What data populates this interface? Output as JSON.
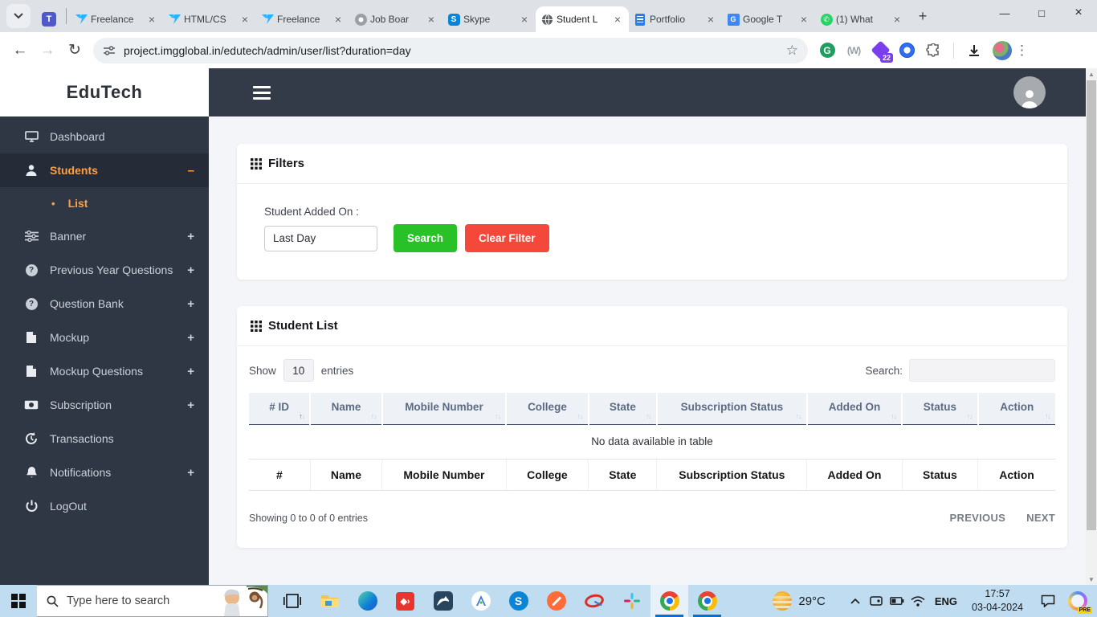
{
  "glyphs": {
    "plus": "+",
    "minus": "–",
    "bullet": "•",
    "question": "?",
    "close": "×",
    "new_tab": "+",
    "minimize": "—",
    "maximize": "□",
    "back": "←",
    "forward": "→",
    "reload": "↻",
    "star": "☆",
    "kebab": "⋮",
    "sort_up": "↑",
    "sort_down": "↓",
    "scroll_up": "▲",
    "scroll_down": "▼",
    "teams": "T",
    "grammarly": "G",
    "gray_ext": "(W)",
    "skype": "S",
    "chevron_up": "⌃"
  },
  "browser": {
    "tabs": [
      {
        "title": "Freelance"
      },
      {
        "title": "HTML/CS"
      },
      {
        "title": "Freelance"
      },
      {
        "title": "Job Boar"
      },
      {
        "title": "Skype"
      },
      {
        "title": "Student L",
        "active": true
      },
      {
        "title": "Portfolio"
      },
      {
        "title": "Google T"
      },
      {
        "title": "(1) What"
      }
    ],
    "url": "project.imgglobal.in/edutech/admin/user/list?duration=day",
    "extension_badge": "22"
  },
  "sidebar": {
    "logo": "EduTech",
    "items": [
      {
        "label": "Dashboard"
      },
      {
        "label": "Students"
      },
      {
        "label": "List"
      },
      {
        "label": "Banner"
      },
      {
        "label": "Previous Year Questions"
      },
      {
        "label": "Question Bank"
      },
      {
        "label": "Mockup"
      },
      {
        "label": "Mockup Questions"
      },
      {
        "label": "Subscription"
      },
      {
        "label": "Transactions"
      },
      {
        "label": "Notifications"
      },
      {
        "label": "LogOut"
      }
    ]
  },
  "filters": {
    "title": "Filters",
    "added_on_label": "Student Added On :",
    "added_on_value": "Last Day",
    "search_button": "Search",
    "clear_button": "Clear Filter"
  },
  "student_list": {
    "title": "Student List",
    "show_label": "Show",
    "entries_value": "10",
    "entries_label": "entries",
    "search_label": "Search:",
    "headers": [
      "# ID",
      "Name",
      "Mobile Number",
      "College",
      "State",
      "Subscription Status",
      "Added On",
      "Status",
      "Action"
    ],
    "footers": [
      "#",
      "Name",
      "Mobile Number",
      "College",
      "State",
      "Subscription Status",
      "Added On",
      "Status",
      "Action"
    ],
    "empty_text": "No data available in table",
    "info": "Showing 0 to 0 of 0 entries",
    "prev": "PREVIOUS",
    "next": "NEXT"
  },
  "taskbar": {
    "search_placeholder": "Type here to search",
    "weather_temp": "29°C",
    "language": "ENG",
    "time": "17:57",
    "date": "03-04-2024",
    "copilot_badge": "PRE"
  },
  "colors": {
    "accent_orange": "#ff9f43",
    "sidebar_dark": "#2f3644",
    "topbar_dark": "#333a48",
    "button_green": "#28c128",
    "button_red": "#f4483a",
    "taskbar_blue": "#bfdcf0"
  }
}
